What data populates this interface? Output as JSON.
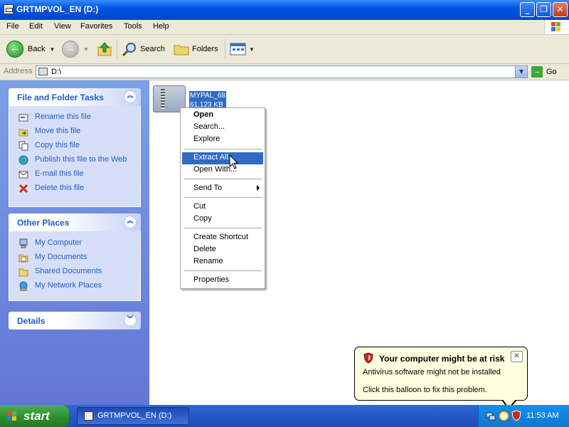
{
  "window": {
    "title": "GRTMPVOL_EN (D:)"
  },
  "menubar": {
    "items": [
      "File",
      "Edit",
      "View",
      "Favorites",
      "Tools",
      "Help"
    ]
  },
  "toolbar": {
    "back": "Back",
    "search": "Search",
    "folders": "Folders"
  },
  "address": {
    "label": "Address",
    "value": "D:\\",
    "go": "Go"
  },
  "sidebar": {
    "file_tasks": {
      "title": "File and Folder Tasks",
      "items": [
        {
          "label": "Rename this file",
          "icon": "rename-icon"
        },
        {
          "label": "Move this file",
          "icon": "move-icon"
        },
        {
          "label": "Copy this file",
          "icon": "copy-icon"
        },
        {
          "label": "Publish this file to the Web",
          "icon": "globe-icon"
        },
        {
          "label": "E-mail this file",
          "icon": "email-icon"
        },
        {
          "label": "Delete this file",
          "icon": "delete-icon"
        }
      ]
    },
    "other_places": {
      "title": "Other Places",
      "items": [
        {
          "label": "My Computer",
          "icon": "computer-icon"
        },
        {
          "label": "My Documents",
          "icon": "folder-icon"
        },
        {
          "label": "Shared Documents",
          "icon": "folder-icon"
        },
        {
          "label": "My Network Places",
          "icon": "network-icon"
        }
      ]
    },
    "details": {
      "title": "Details"
    }
  },
  "file": {
    "name": "MYPAL_68",
    "size": "61,123 KB"
  },
  "context_menu": {
    "items": [
      "Open",
      "Search...",
      "Explore",
      "Extract All...",
      "Open With...",
      "Send To",
      "Cut",
      "Copy",
      "Create Shortcut",
      "Delete",
      "Rename",
      "Properties"
    ],
    "highlighted": "Extract All..."
  },
  "balloon": {
    "title": "Your computer might be at risk",
    "line1": "Antivirus software might not be installed",
    "line2": "Click this balloon to fix this problem."
  },
  "taskbar": {
    "start": "start",
    "task_button": "GRTMPVOL_EN (D:)",
    "clock": "11:53 AM"
  },
  "colors": {
    "xp_blue": "#0054e3",
    "selection": "#316ac5",
    "panel_link": "#215dc6",
    "balloon_bg": "#ffffe1",
    "start_green": "#2f8f2f"
  }
}
